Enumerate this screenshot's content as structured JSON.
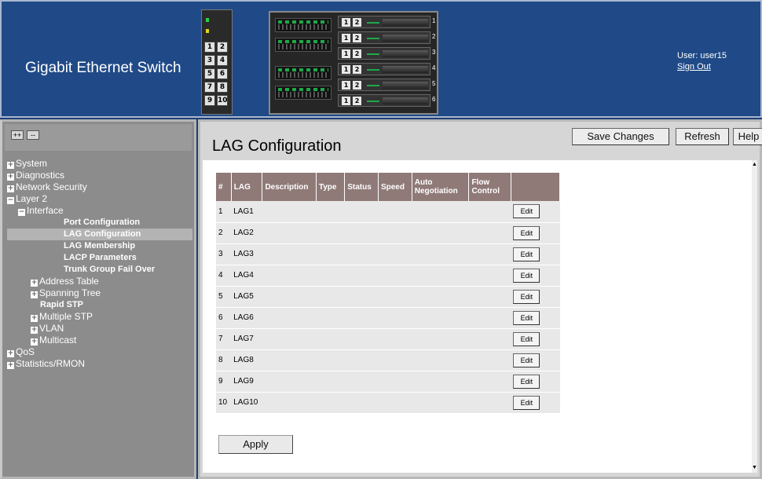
{
  "header": {
    "brand": "Gigabit Ethernet Switch",
    "user_label": "User: user15",
    "sign_out": "Sign Out",
    "panel_ports": [
      [
        "1",
        "2"
      ],
      [
        "3",
        "4"
      ],
      [
        "5",
        "6"
      ],
      [
        "7",
        "8"
      ],
      [
        "9",
        "10"
      ]
    ],
    "blade_ports": [
      "1",
      "2"
    ],
    "slot_numbers": [
      "1",
      "2",
      "3",
      "4",
      "5",
      "6"
    ]
  },
  "nav": {
    "expand_label": "++",
    "collapse_label": "--",
    "tree": [
      {
        "label": "System",
        "level": 1,
        "toggle": "+"
      },
      {
        "label": "Diagnostics",
        "level": 1,
        "toggle": "+"
      },
      {
        "label": "Network Security",
        "level": 1,
        "toggle": "+"
      },
      {
        "label": "Layer 2",
        "level": 1,
        "toggle": "−"
      },
      {
        "label": "Interface",
        "level": 2,
        "toggle": "−"
      },
      {
        "label": "Port Configuration",
        "level": 4,
        "toggle": ""
      },
      {
        "label": "LAG Configuration",
        "level": 4,
        "toggle": "",
        "selected": true
      },
      {
        "label": "LAG Membership",
        "level": 4,
        "toggle": ""
      },
      {
        "label": "LACP Parameters",
        "level": 4,
        "toggle": ""
      },
      {
        "label": "Trunk Group Fail Over",
        "level": 4,
        "toggle": ""
      },
      {
        "label": "Address Table",
        "level": 3,
        "toggle": "+"
      },
      {
        "label": "Spanning Tree",
        "level": 3,
        "toggle": "+"
      },
      {
        "label": "Rapid STP",
        "level": 4,
        "toggle": "",
        "indent": "rapid"
      },
      {
        "label": "Multiple STP",
        "level": 3,
        "toggle": "+"
      },
      {
        "label": "VLAN",
        "level": 3,
        "toggle": "+"
      },
      {
        "label": "Multicast",
        "level": 3,
        "toggle": "+"
      },
      {
        "label": "QoS",
        "level": 1,
        "toggle": "+"
      },
      {
        "label": "Statistics/RMON",
        "level": 1,
        "toggle": "+"
      }
    ]
  },
  "main": {
    "title": "LAG Configuration",
    "save_label": "Save Changes",
    "refresh_label": "Refresh",
    "help_label": "Help",
    "apply_label": "Apply",
    "table": {
      "headers": [
        "#",
        "LAG",
        "Description",
        "Type",
        "Status",
        "Speed",
        "Auto Negotiation",
        "Flow Control",
        ""
      ],
      "edit_label": "Edit",
      "rows": [
        {
          "num": "1",
          "lag": "LAG1"
        },
        {
          "num": "2",
          "lag": "LAG2"
        },
        {
          "num": "3",
          "lag": "LAG3"
        },
        {
          "num": "4",
          "lag": "LAG4"
        },
        {
          "num": "5",
          "lag": "LAG5"
        },
        {
          "num": "6",
          "lag": "LAG6"
        },
        {
          "num": "7",
          "lag": "LAG7"
        },
        {
          "num": "8",
          "lag": "LAG8"
        },
        {
          "num": "9",
          "lag": "LAG9"
        },
        {
          "num": "10",
          "lag": "LAG10"
        }
      ]
    }
  },
  "colors": {
    "header_bg": "#204a87",
    "nav_bg": "#8c8c8c",
    "table_header_bg": "#8f7a78",
    "selected_bg": "#b3b3b3"
  }
}
